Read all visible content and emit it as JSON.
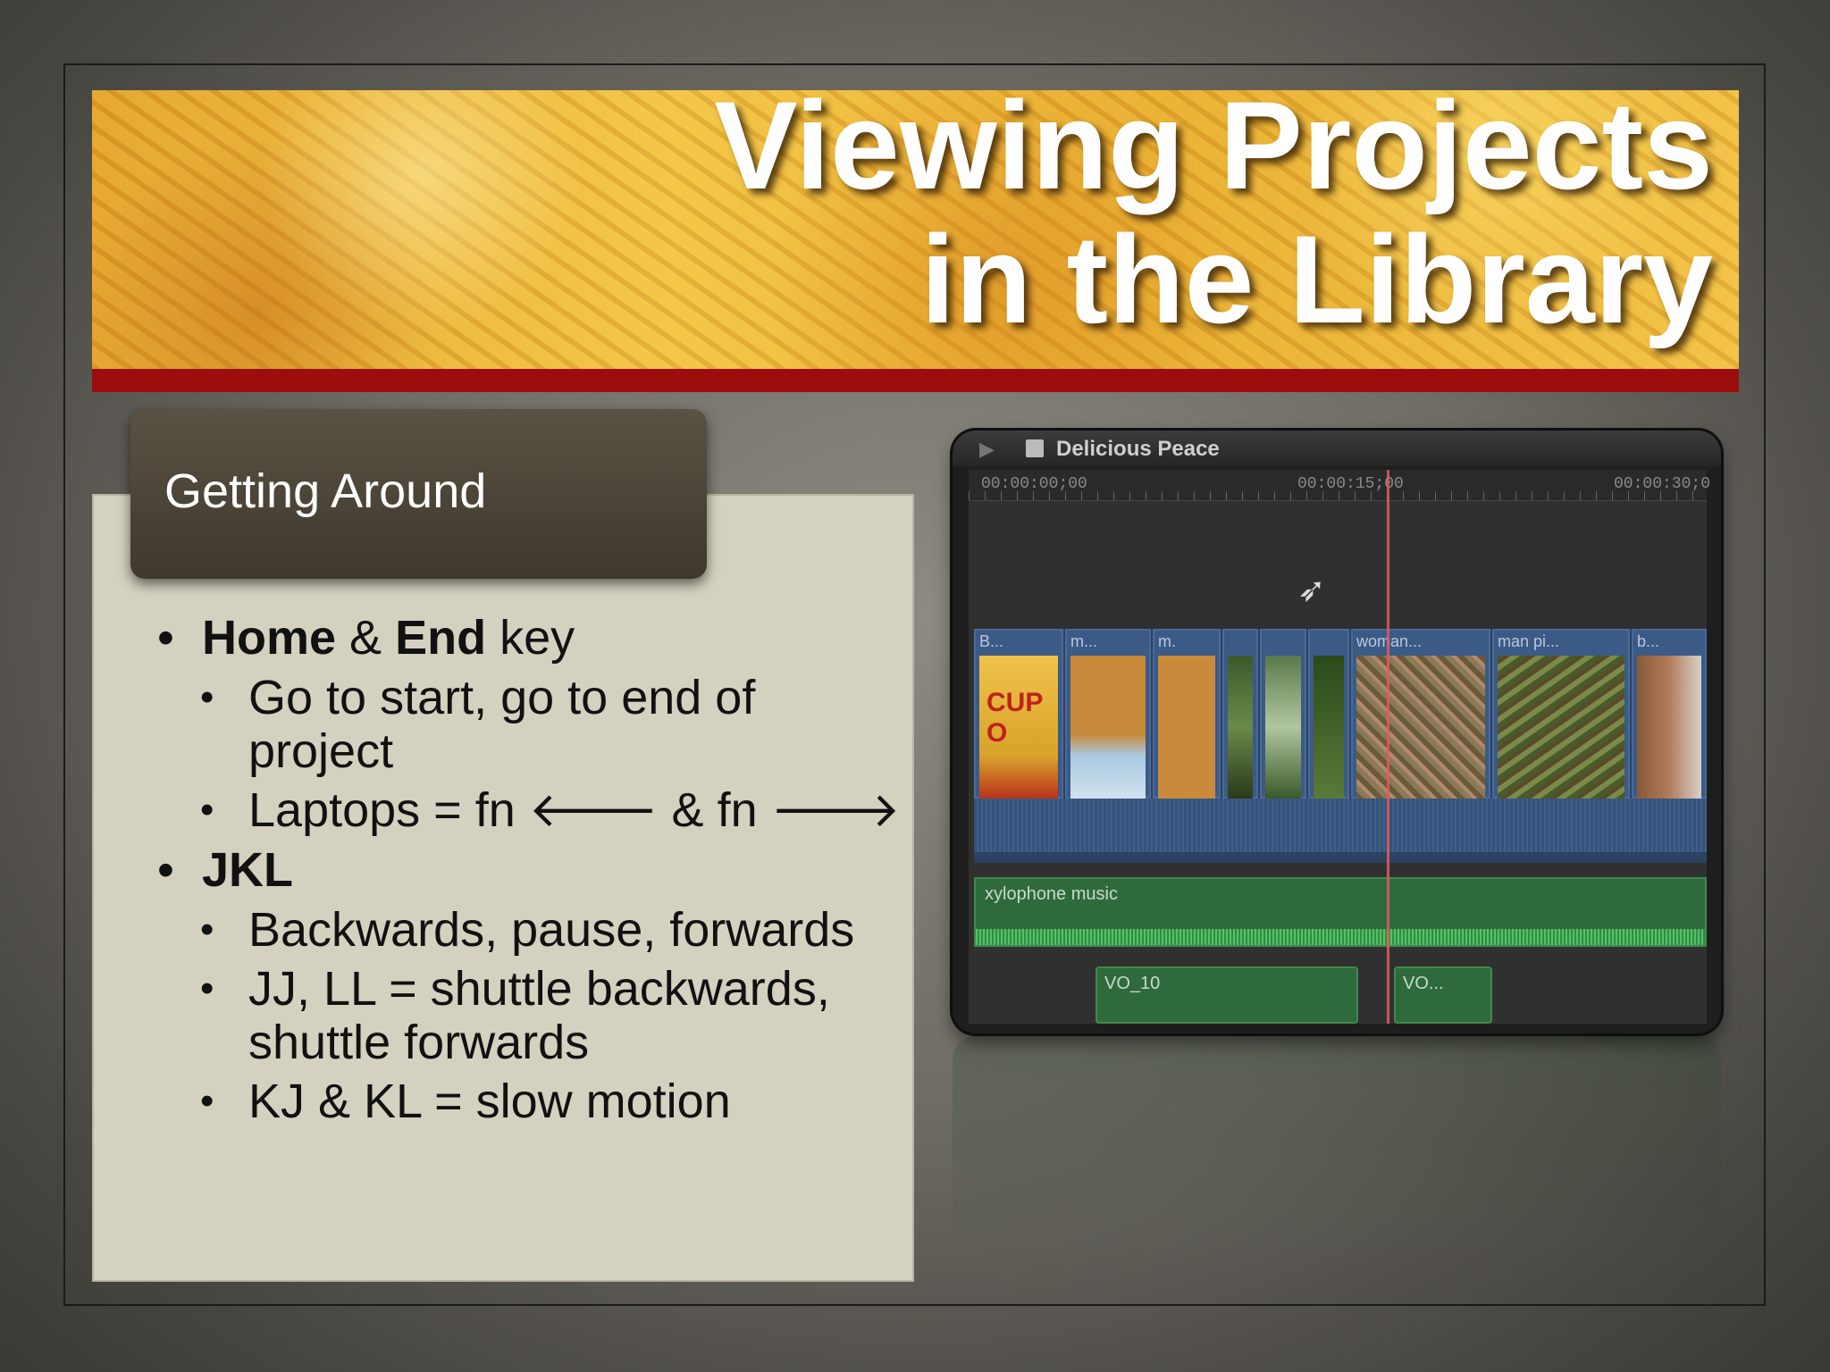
{
  "slide": {
    "title_line1": "Viewing Projects",
    "title_line2": "in the Library",
    "section_label": "Getting Around",
    "bullets": {
      "b1_bold_a": "Home",
      "b1_mid": " & ",
      "b1_bold_b": "End",
      "b1_tail": " key",
      "b1_sub1": "Go to start, go to end of project",
      "b1_sub2": "Laptops = fn 🡐 & fn 🡒",
      "b2_bold": "JKL",
      "b2_sub1": "Backwards, pause, forwards",
      "b2_sub2": "JJ, LL = shuttle backwards, shuttle forwards",
      "b2_sub3": "KJ & KL = slow motion"
    },
    "colors": {
      "banner_rule": "#9b0d0d",
      "panel": "#d5d1c1",
      "tab": "#4a4336"
    }
  },
  "timeline": {
    "project_name": "Delicious Peace",
    "timecodes": [
      "00:00:00;00",
      "00:00:15;00",
      "00:00:30;0"
    ],
    "clips": [
      {
        "label": "B..."
      },
      {
        "label": "m..."
      },
      {
        "label": "m."
      },
      {
        "label": ""
      },
      {
        "label": ""
      },
      {
        "label": ""
      },
      {
        "label": "woman..."
      },
      {
        "label": "man pi..."
      },
      {
        "label": "b..."
      }
    ],
    "cup_text": "CUP O",
    "music_label": "xylophone music",
    "vo_labels": [
      "VO_10",
      "VO..."
    ],
    "icons": [
      "play-icon",
      "film-icon",
      "pointer-cursor-icon"
    ]
  }
}
